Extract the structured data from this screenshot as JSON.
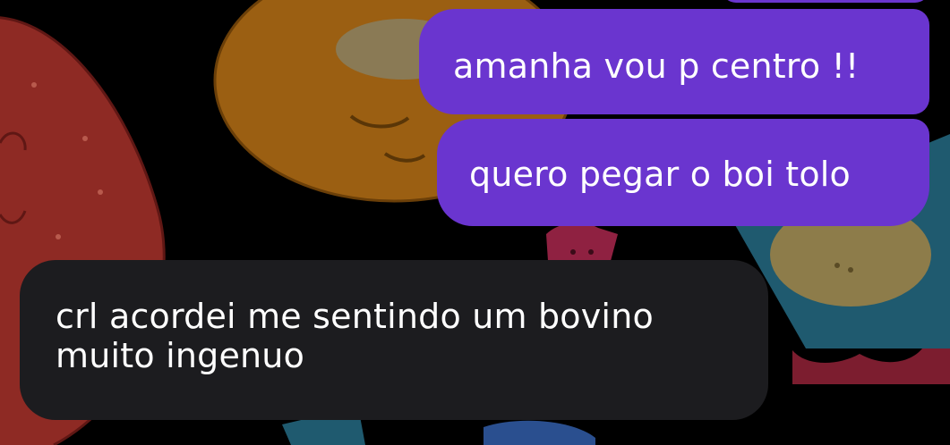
{
  "chat": {
    "messages": [
      {
        "direction": "outgoing",
        "text": "amanha vou p centro !!"
      },
      {
        "direction": "outgoing",
        "text": "quero pegar o boi tolo"
      },
      {
        "direction": "incoming",
        "lines": [
          "crl acordei me sentindo um bovino",
          "muito ingenuo"
        ]
      }
    ]
  },
  "colors": {
    "outgoing_bubble": "#6a35cf",
    "incoming_bubble": "#1c1c1f",
    "background": "#000000",
    "text": "#ffffff"
  },
  "wallpaper": {
    "icons": [
      "strawberry-icon",
      "donut-icon",
      "popsicle-icon",
      "cookie-bag-icon",
      "blue-cup-icon"
    ]
  }
}
